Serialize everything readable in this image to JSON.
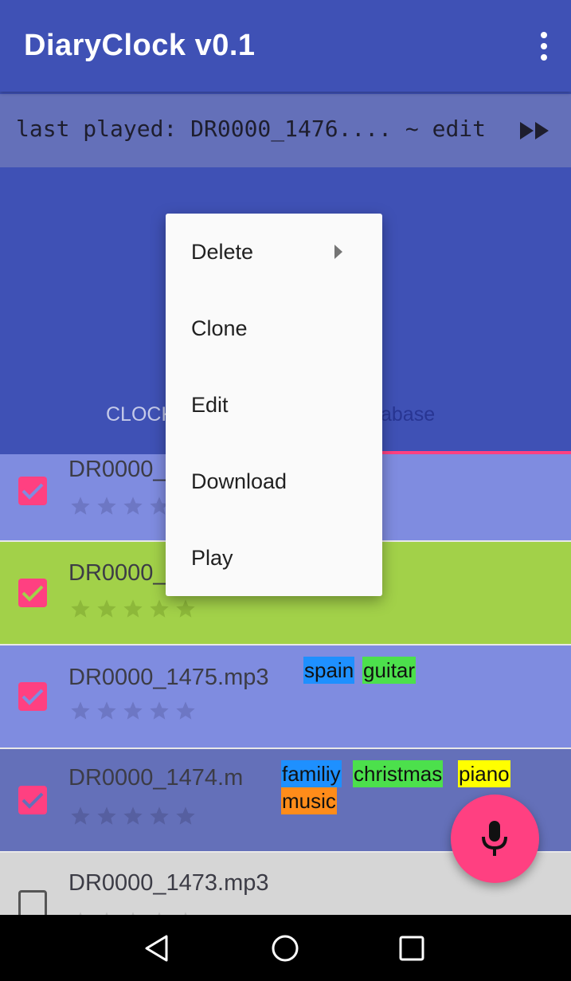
{
  "app": {
    "title": "DiaryClock v0.1",
    "overflow_icon": "more-vert-icon"
  },
  "last_played": {
    "text": "last played: DR0000_1476.... ~ edit",
    "icon": "fast-forward-icon"
  },
  "tabs": [
    {
      "label": "CLOCK",
      "selected": false
    },
    {
      "label": "abase",
      "selected": true
    }
  ],
  "context_menu": {
    "items": [
      {
        "label": "Delete",
        "has_submenu": true
      },
      {
        "label": "Clone"
      },
      {
        "label": "Edit"
      },
      {
        "label": "Download"
      },
      {
        "label": "Play"
      }
    ]
  },
  "recordings": [
    {
      "filename": "DR0000_",
      "checked": true,
      "bg": "#7f8ce0",
      "tags": []
    },
    {
      "filename": "DR0000_",
      "checked": true,
      "bg": "#a2d149",
      "tags": []
    },
    {
      "filename": "DR0000_1475.mp3",
      "checked": true,
      "bg": "#7f8ce0",
      "tags": [
        {
          "text": "spain",
          "color": "#1e90ff"
        },
        {
          "text": "guitar",
          "color": "#4ce04c"
        }
      ]
    },
    {
      "filename": "DR0000_1474.m",
      "checked": true,
      "bg": "#6470b9",
      "tags": [
        {
          "text": "familiy",
          "color": "#1e90ff"
        },
        {
          "text": "christmas",
          "color": "#4ce04c"
        },
        {
          "text": "piano",
          "color": "#ffff00"
        },
        {
          "text": "music",
          "color": "#ff8c1a"
        }
      ]
    },
    {
      "filename": "DR0000_1473.mp3",
      "checked": false,
      "bg": "#d6d6d6",
      "tags": []
    }
  ],
  "fab": {
    "icon": "microphone-icon"
  },
  "nav": {
    "back": "back-icon",
    "home": "home-icon",
    "recents": "recents-icon"
  },
  "colors": {
    "primary": "#3f51b5",
    "accent": "#ff4081"
  }
}
